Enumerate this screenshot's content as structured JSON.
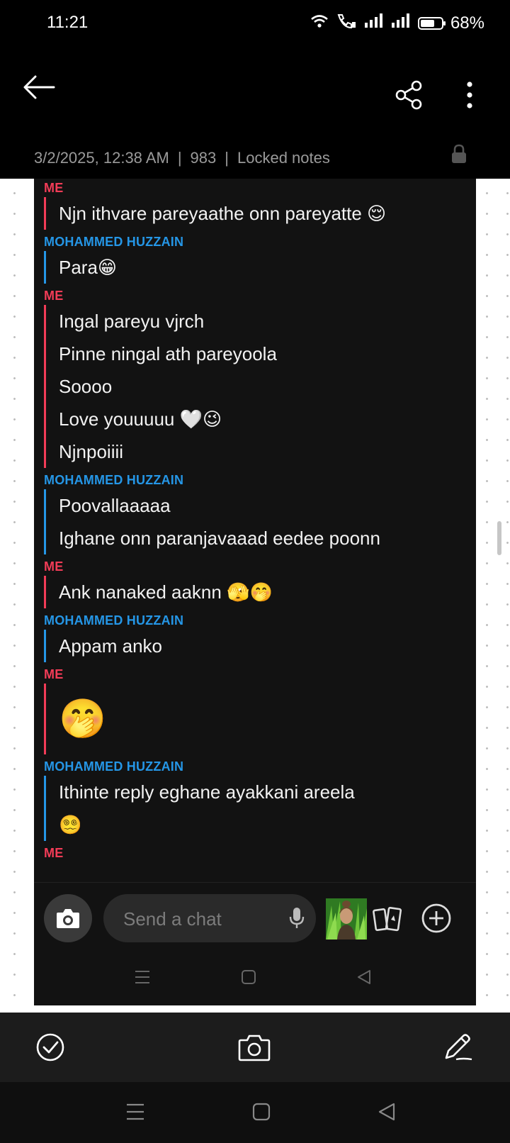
{
  "status_bar": {
    "time": "11:21",
    "battery": "68%",
    "battery_level": 0.68,
    "icons": [
      "wifi-icon",
      "wifi-call-icon",
      "signal-icon",
      "signal-icon",
      "battery-icon"
    ]
  },
  "header": {
    "back_icon": "arrow-left-icon",
    "share_icon": "share-icon",
    "menu_icon": "more-vertical-icon"
  },
  "note_meta": {
    "date": "3/2/2025, 12:38 AM",
    "separator": "|",
    "char_count": "983",
    "folder": "Locked notes",
    "lock_icon": "lock-icon"
  },
  "chat": {
    "groups": [
      {
        "sender": "ME",
        "side": "me",
        "lines": [
          "Njn ithvare pareyaathe onn pareyatte 😌"
        ]
      },
      {
        "sender": "MOHAMMED HUZZAIN",
        "side": "him",
        "lines": [
          "Para😁"
        ]
      },
      {
        "sender": "ME",
        "side": "me",
        "lines": [
          "Ingal pareyu vjrch",
          "Pinne ningal ath pareyoola",
          "Soooo",
          "Love youuuuu 🤍😉",
          "Njnpoiiii"
        ]
      },
      {
        "sender": "MOHAMMED HUZZAIN",
        "side": "him",
        "lines": [
          "Poovallaaaaa",
          "Ighane onn paranjavaaad eedee poonn"
        ]
      },
      {
        "sender": "ME",
        "side": "me",
        "lines": [
          "Ank nanaked aaknn 🫣🤭"
        ]
      },
      {
        "sender": "MOHAMMED HUZZAIN",
        "side": "him",
        "lines": [
          "Appam anko"
        ]
      },
      {
        "sender": "ME",
        "side": "me",
        "lines": [
          "🤭"
        ],
        "big": true
      },
      {
        "sender": "MOHAMMED HUZZAIN",
        "side": "him",
        "lines": [
          "Ithinte reply eghane ayakkani areela",
          "😵‍💫"
        ]
      },
      {
        "sender": "ME",
        "side": "me",
        "lines": []
      }
    ]
  },
  "composer": {
    "placeholder": "Send a chat",
    "camera_icon": "camera-icon",
    "mic_icon": "mic-icon",
    "cards_icon": "cards-icon",
    "add_icon": "plus-circle-icon"
  },
  "toolbar": {
    "icons": [
      "check-circle-icon",
      "camera-icon",
      "pencil-icon"
    ]
  },
  "navigation": {
    "icons": [
      "menu-lines-icon",
      "home-square-icon",
      "back-triangle-icon"
    ]
  },
  "colors": {
    "me": "#f23c57",
    "him": "#2596e6",
    "chat_bg": "#121212",
    "toolbar_bg": "#1c1c1c"
  }
}
